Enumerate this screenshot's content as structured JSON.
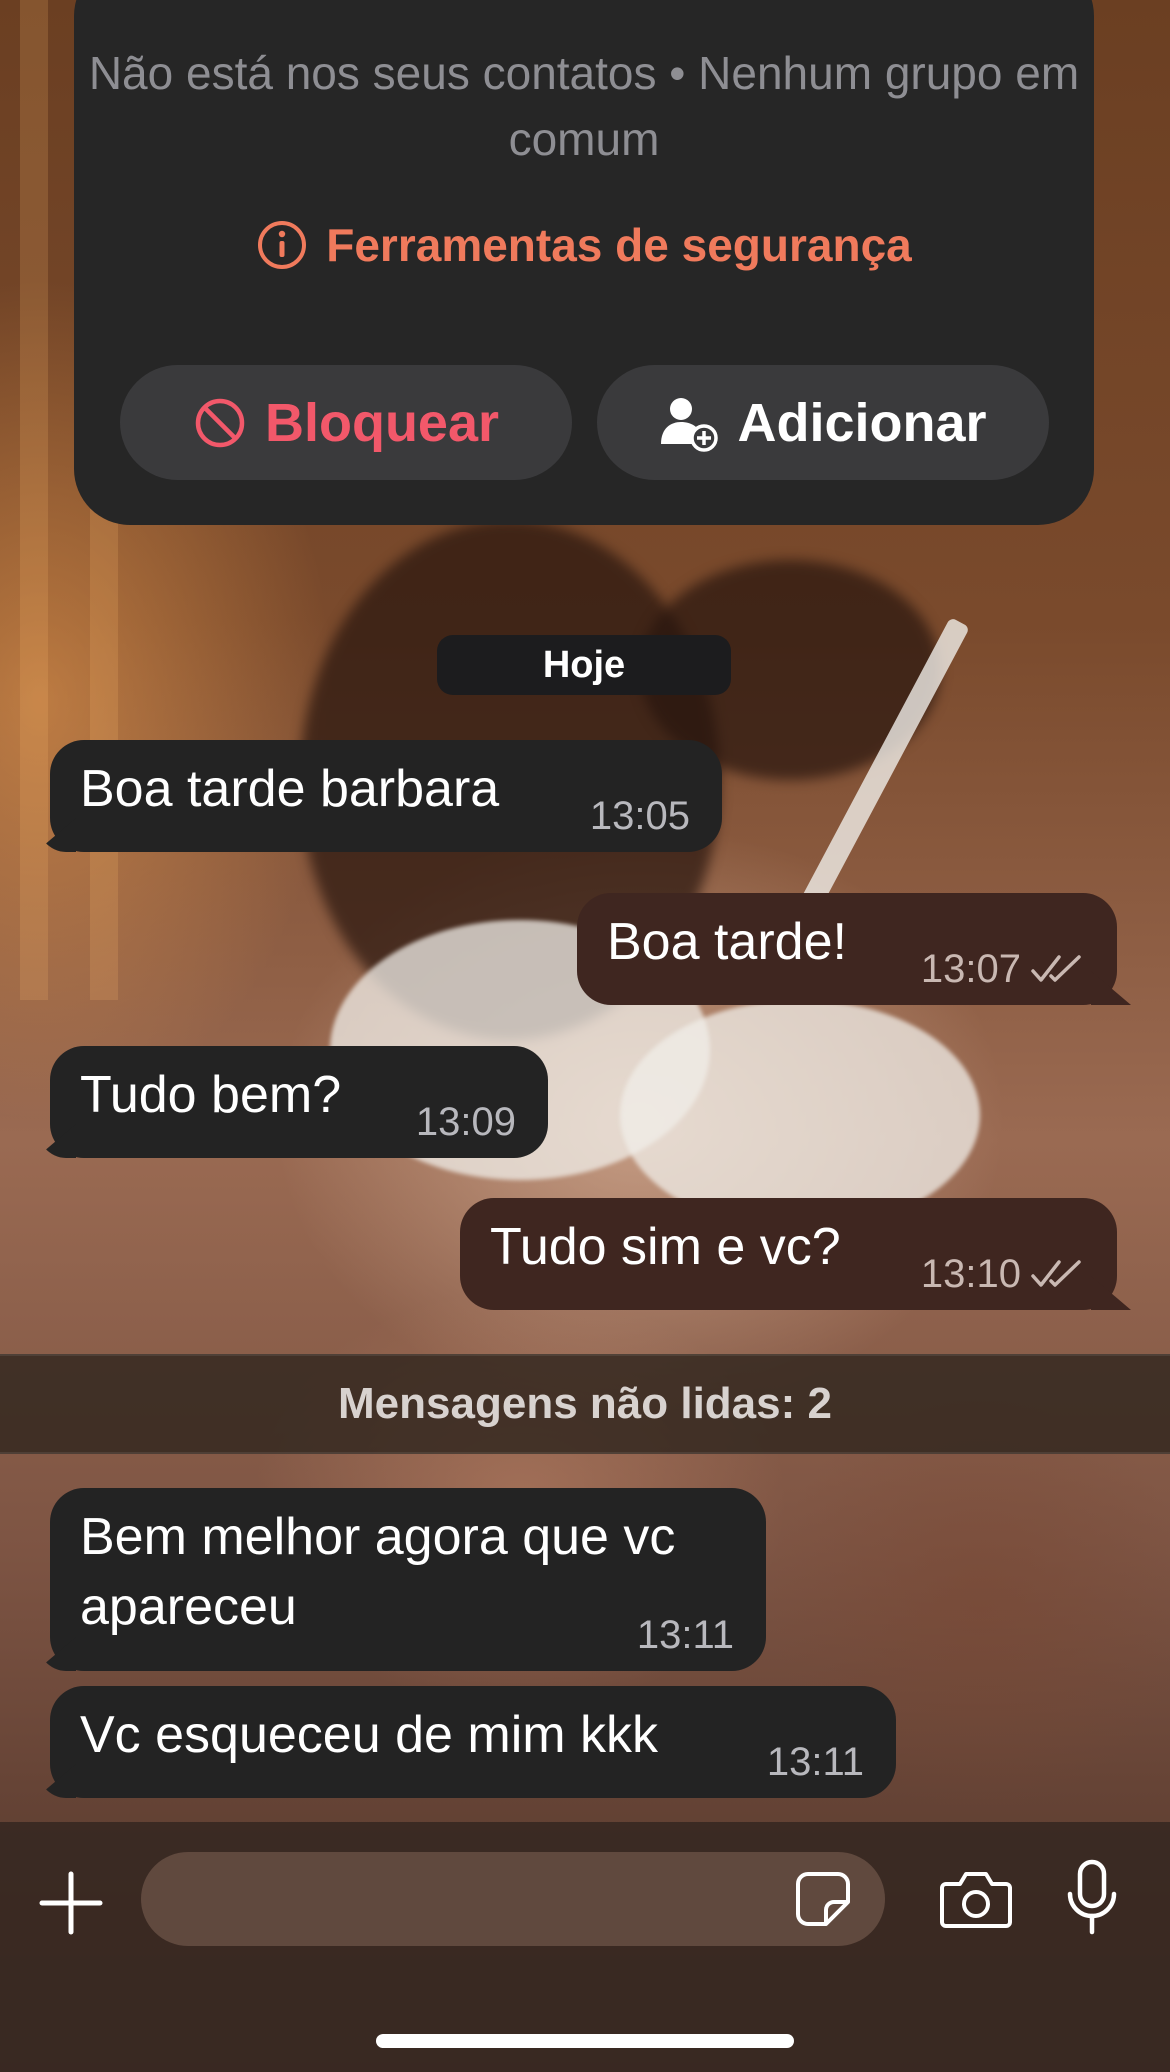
{
  "contact_card": {
    "info_text": "Não está nos seus contatos • Nenhum grupo em comum",
    "safety_tools_label": "Ferramentas de segurança",
    "block_label": "Bloquear",
    "add_label": "Adicionar"
  },
  "date_chip": "Hoje",
  "messages": [
    {
      "direction": "incoming",
      "text": "Boa tarde barbara",
      "time": "13:05"
    },
    {
      "direction": "outgoing",
      "text": "Boa tarde!",
      "time": "13:07",
      "status": "read"
    },
    {
      "direction": "incoming",
      "text": "Tudo bem?",
      "time": "13:09"
    },
    {
      "direction": "outgoing",
      "text": "Tudo sim e vc?",
      "time": "13:10",
      "status": "read"
    },
    {
      "direction": "incoming",
      "text": "Bem melhor agora que vc apareceu",
      "time": "13:11"
    },
    {
      "direction": "incoming",
      "text": "Vc esqueceu de mim kkk",
      "time": "13:11"
    }
  ],
  "unread_divider": "Mensagens não lidas: 2",
  "composer": {
    "input_value": "",
    "icons": [
      "plus-icon",
      "sticker-icon",
      "camera-icon",
      "microphone-icon"
    ]
  },
  "colors": {
    "incoming_bubble": "#232323",
    "outgoing_bubble": "#3f2620",
    "safety_link": "#f07a5c",
    "block_red": "#f2586a"
  }
}
